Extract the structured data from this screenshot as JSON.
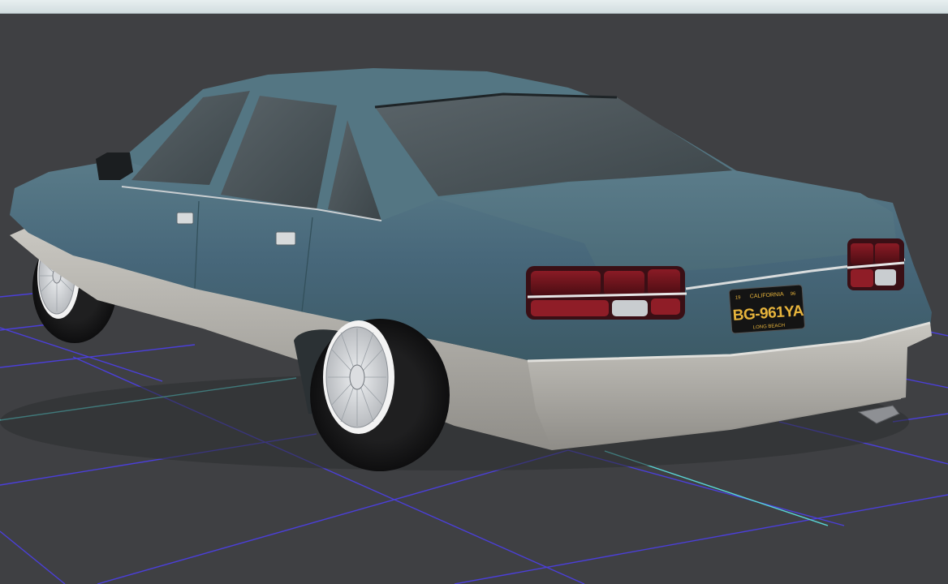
{
  "viewport": {
    "background_color": "#3f4043",
    "sky_strip_color": "#dfe8ea",
    "grid_color": "#4b3fd9",
    "grid_axis_color": "#59d6d6"
  },
  "car": {
    "body_color": "#4b6b78",
    "lower_trim_color": "#b5b3ad",
    "license_plate": {
      "state": "CALIFORNIA",
      "number": "BG-961YA",
      "city": "LONG BEACH",
      "year_left": "19",
      "year_right": "96",
      "plate_color": "#141414",
      "text_color": "#e7b43c"
    }
  }
}
